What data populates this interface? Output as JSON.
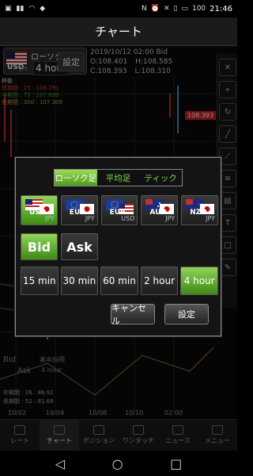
{
  "status": {
    "time": "21:46",
    "battery": "100"
  },
  "title": "チャート",
  "pair": {
    "name": "ローソク",
    "base": "USD",
    "quote": "JPY",
    "timeframe": "4 hour"
  },
  "top_setting_label": "設定",
  "ohlc": {
    "date": "2019/10/12 02:00 Bid",
    "o_label": "O:",
    "o": "108.401",
    "h_label": "H:",
    "h": "108.585",
    "c_label": "C:",
    "c": "108.393",
    "l_label": "L:",
    "l": "108.310"
  },
  "indicators": {
    "title": "移動",
    "short": "短期間 : 25 : 108.291",
    "mid": "中期間 : 75 : 107.899",
    "long": "長期間 : 300 : 107.309"
  },
  "price_tag": "108.393",
  "sub": {
    "bid": "Bid",
    "ask": "Ask",
    "basic": "基本指標",
    "interval": "4 hour",
    "mid": "中期間 : 26 : 86.92",
    "long": "長期間 : 52 : 81.69"
  },
  "dates": [
    "10/02",
    "10/04",
    "10/08",
    "10/10",
    "02:00"
  ],
  "tabs": [
    "レート",
    "チャート",
    "ポジション",
    "ワンタッチ",
    "ニュース",
    "メニュー"
  ],
  "dialog": {
    "chart_types": [
      "ローソク足",
      "平均足",
      "ティック"
    ],
    "currencies": [
      {
        "code1": "USD",
        "code2": "JPY"
      },
      {
        "code1": "EUR",
        "code2": "JPY"
      },
      {
        "code1": "EUR",
        "code2": "USD"
      },
      {
        "code1": "AUD",
        "code2": "JPY"
      },
      {
        "code1": "NZD",
        "code2": "JPY"
      }
    ],
    "bid": "Bid",
    "ask": "Ask",
    "timeframes": [
      "15 min",
      "30 min",
      "60 min",
      "2 hour",
      "4 hour"
    ],
    "cancel": "キャンセル",
    "ok": "設定"
  },
  "colors": {
    "accent": "#6cc234",
    "price_tag": "#d32020"
  }
}
